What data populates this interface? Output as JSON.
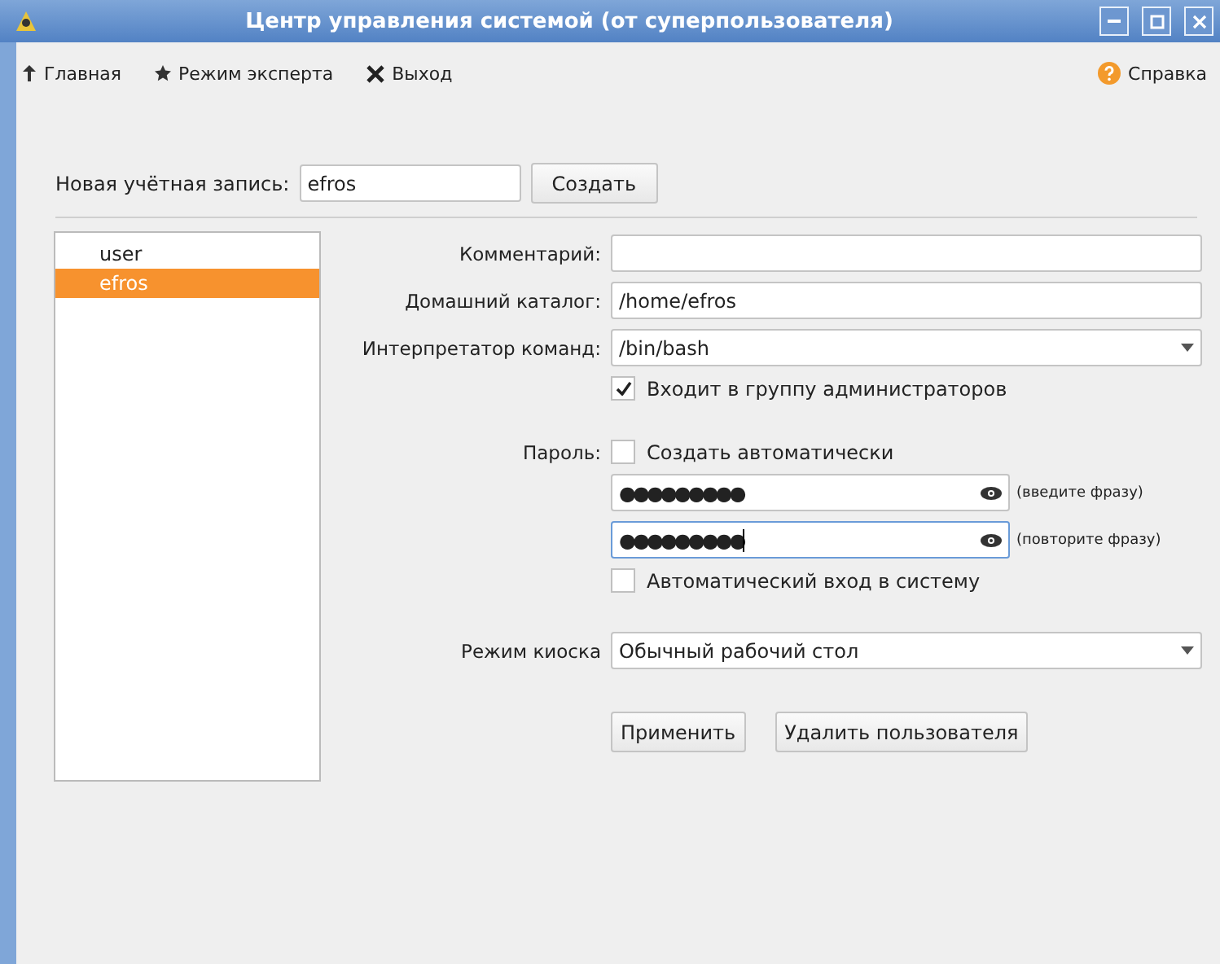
{
  "window": {
    "title": "Центр управления системой (от суперпользователя)"
  },
  "toolbar": [
    {
      "kind": "up",
      "label": "Главная"
    },
    {
      "kind": "star",
      "label": "Режим эксперта"
    },
    {
      "kind": "exit",
      "label": "Выход"
    }
  ],
  "help": {
    "label": "Справка"
  },
  "new_account": {
    "label": "Новая учётная запись:",
    "value": "efros",
    "button": "Создать"
  },
  "users": [
    {
      "name": "user",
      "selected": false
    },
    {
      "name": "efros",
      "selected": true
    }
  ],
  "form": {
    "comment": {
      "label": "Комментарий:"
    },
    "home": {
      "label": "Домашний каталог:",
      "value": "/home/efros"
    },
    "shell": {
      "label": "Интерпретатор команд:",
      "value": "/bin/bash"
    },
    "admin": {
      "label": "Входит в группу администраторов",
      "checked": true
    },
    "password": {
      "label": "Пароль:",
      "auto": {
        "label": "Создать автоматически",
        "checked": false
      },
      "fields": [
        {
          "value": "●●●●●●●●●",
          "hint": "(введите фразу)",
          "focused": false
        },
        {
          "value": "●●●●●●●●●",
          "hint": "(повторите фразу)",
          "focused": true
        }
      ]
    },
    "autologin": {
      "label": "Автоматический вход в систему",
      "checked": false
    },
    "kiosk": {
      "label": "Режим киоска",
      "value": "Обычный рабочий стол"
    },
    "buttons": [
      "Применить",
      "Удалить пользователя"
    ]
  }
}
